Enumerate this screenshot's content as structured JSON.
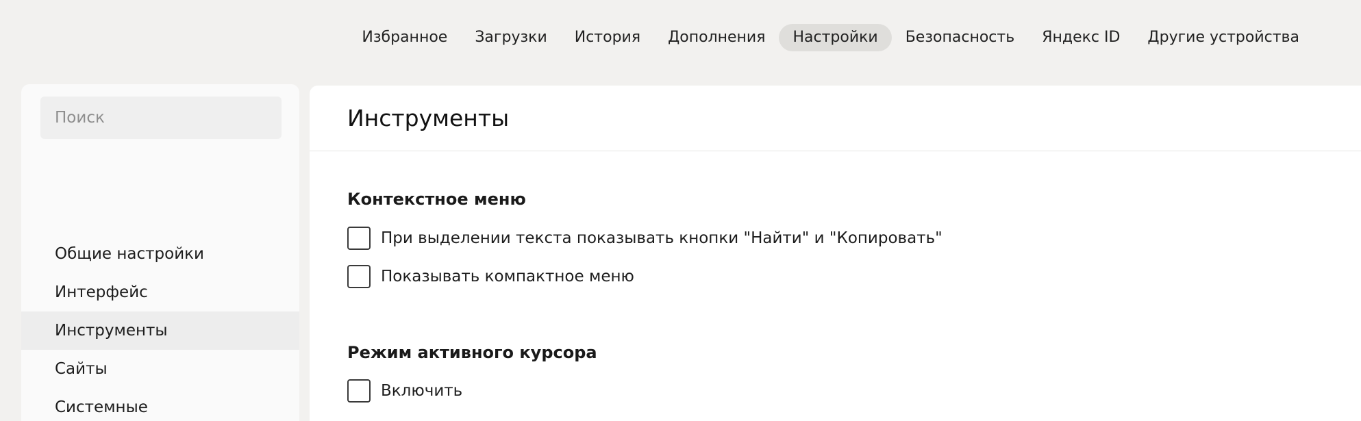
{
  "topnav": {
    "tabs": [
      {
        "label": "Избранное",
        "active": false
      },
      {
        "label": "Загрузки",
        "active": false
      },
      {
        "label": "История",
        "active": false
      },
      {
        "label": "Дополнения",
        "active": false
      },
      {
        "label": "Настройки",
        "active": true
      },
      {
        "label": "Безопасность",
        "active": false
      },
      {
        "label": "Яндекс ID",
        "active": false
      },
      {
        "label": "Другие устройства",
        "active": false
      }
    ]
  },
  "sidebar": {
    "search_placeholder": "Поиск",
    "items": [
      {
        "label": "Общие настройки",
        "active": false
      },
      {
        "label": "Интерфейс",
        "active": false
      },
      {
        "label": "Инструменты",
        "active": true
      },
      {
        "label": "Сайты",
        "active": false
      },
      {
        "label": "Системные",
        "active": false
      }
    ]
  },
  "main": {
    "title": "Инструменты",
    "sections": [
      {
        "title": "Контекстное меню",
        "options": [
          {
            "label": "При выделении текста показывать кнопки \"Найти\" и \"Копировать\"",
            "checked": false
          },
          {
            "label": "Показывать компактное меню",
            "checked": false
          }
        ]
      },
      {
        "title": "Режим активного курсора",
        "options": [
          {
            "label": "Включить",
            "checked": false
          }
        ]
      }
    ]
  },
  "colors": {
    "page_background": "#f2f1ef",
    "active_tab": "#dfdedb",
    "active_sidebar_item": "#ededed"
  }
}
